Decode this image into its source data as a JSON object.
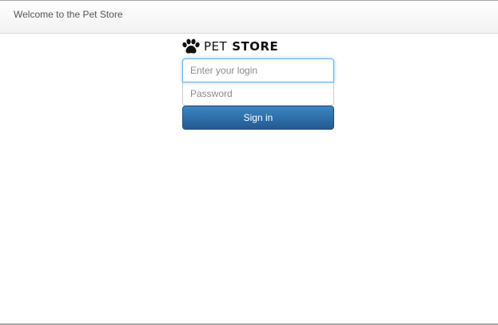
{
  "navbar": {
    "brand_text": "Welcome to the Pet Store"
  },
  "logo": {
    "icon": "paw-icon",
    "pet_text": "PET",
    "store_text": "STORE"
  },
  "login_form": {
    "login_placeholder": "Enter your login",
    "login_value": "",
    "password_placeholder": "Password",
    "password_value": "",
    "signin_label": "Sign in"
  },
  "colors": {
    "focus_border": "#66afe9",
    "button_top": "#3a86c5",
    "button_bottom": "#24598e"
  }
}
